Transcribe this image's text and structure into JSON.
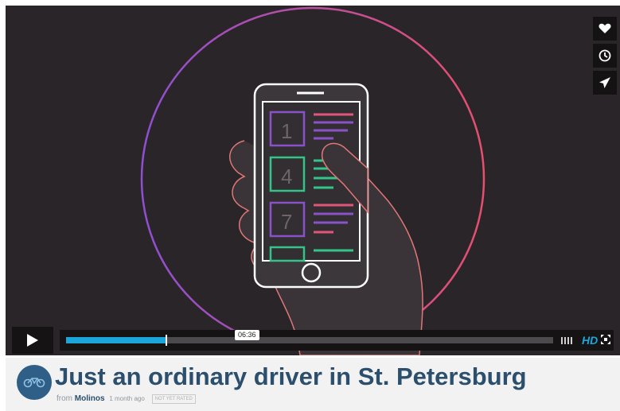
{
  "player": {
    "progress_percent": 20.5,
    "time_tooltip": "06:36",
    "hd_label": "HD",
    "phone_numbers": [
      "1",
      "4",
      "7"
    ],
    "colors": {
      "background": "#2a2529",
      "progress": "#1aa6db",
      "ring_start": "#8e4fd1",
      "ring_end": "#e64f6e",
      "accent_purple": "#8a52c8",
      "accent_green": "#34c48a",
      "accent_pink": "#e2557a"
    },
    "icons": {
      "like": "heart-icon",
      "watch_later": "clock-icon",
      "share": "paper-plane-icon",
      "play": "play-icon",
      "volume": "volume-icon",
      "fullscreen": "fullscreen-icon"
    }
  },
  "video": {
    "title": "Just an ordinary driver in St. Petersburg",
    "from_label": "from",
    "author": "Molinos",
    "uploaded": "1 month ago",
    "rating_badge": "NOT YET RATED"
  }
}
